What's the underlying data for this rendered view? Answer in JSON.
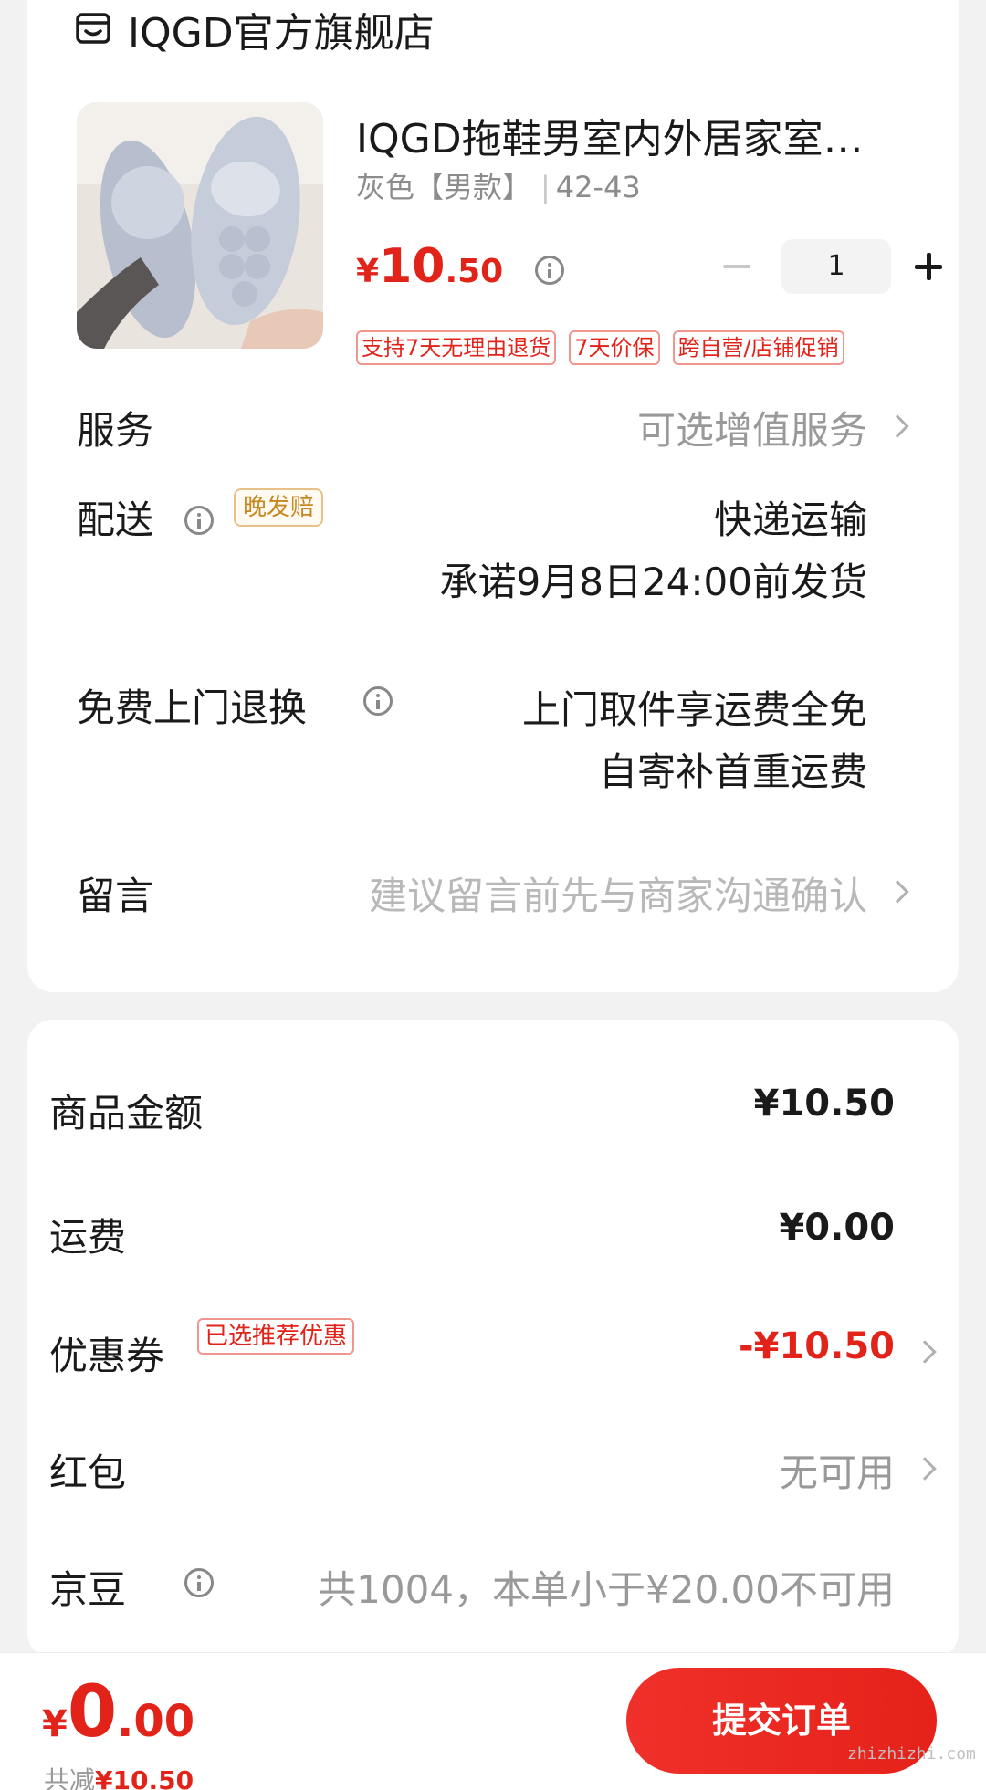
{
  "store": {
    "icon": "store-icon",
    "name": "IQGD官方旗舰店"
  },
  "product": {
    "title": "IQGD拖鞋男室内外居家室…",
    "spec_color": "灰色【男款】",
    "spec_size": "42-43",
    "price_symbol": "¥",
    "price_int": "10",
    "price_dec": ".50",
    "quantity": "1",
    "tags": [
      "支持7天无理由退货",
      "7天价保",
      "跨自营/店铺促销"
    ]
  },
  "service": {
    "label": "服务",
    "value": "可选增值服务"
  },
  "delivery": {
    "label": "配送",
    "badge": "晚发赔",
    "method": "快递运输",
    "promise": "承诺9月8日24:00前发货"
  },
  "return_service": {
    "label": "免费上门退换",
    "line1": "上门取件享运费全免",
    "line2": "自寄补首重运费"
  },
  "message": {
    "label": "留言",
    "placeholder": "建议留言前先与商家沟通确认"
  },
  "summary": {
    "goods_label": "商品金额",
    "goods_value": "¥10.50",
    "shipping_label": "运费",
    "shipping_value": "¥0.00",
    "coupon_label": "优惠券",
    "coupon_badge": "已选推荐优惠",
    "coupon_value": "-¥10.50",
    "redpacket_label": "红包",
    "redpacket_value": "无可用",
    "jingdou_label": "京豆",
    "jingdou_value": "共1004，本单小于¥20.00不可用"
  },
  "bottom": {
    "total_symbol": "¥",
    "total_int": "0",
    "total_dec": ".00",
    "saving_label": "共减",
    "saving_value": "¥10.50",
    "submit_label": "提交订单",
    "watermark": "zhizhizhi.com"
  },
  "colors": {
    "accent": "#e2231a",
    "gold": "#c8861e"
  }
}
